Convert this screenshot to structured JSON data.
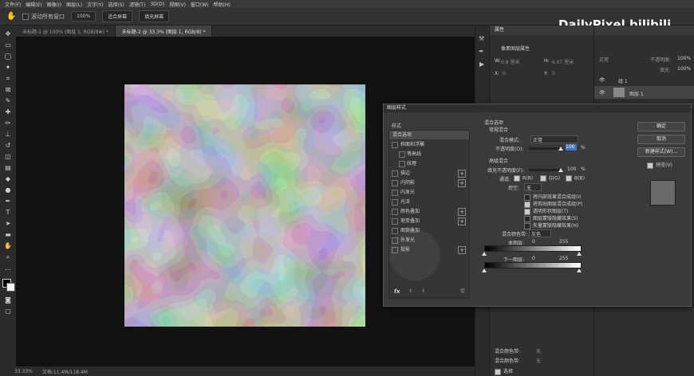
{
  "menubar": {
    "items": [
      "文件(F)",
      "编辑(E)",
      "图像(I)",
      "图层(L)",
      "文字(Y)",
      "选择(S)",
      "滤镜(T)",
      "3D(D)",
      "视图(V)",
      "窗口(W)",
      "帮助(H)"
    ]
  },
  "options": {
    "scroll_all_label": "滚动所有窗口",
    "zoom_value": "100%",
    "fit_screen_label": "适合屏幕",
    "fill_screen_label": "填充屏幕"
  },
  "tabs": [
    {
      "label": "未标题-1 @ 100% (图层 1, RGB/8#) *"
    },
    {
      "label": "未标题-2 @ 33.3% (图层 1, RGB/8) *"
    }
  ],
  "status": {
    "zoom": "33.33%",
    "doc": "文档:11.4M/118.4M"
  },
  "watermark": {
    "text": "DailyPixel bilibili"
  },
  "properties": {
    "title": "属性",
    "subtitle": "像素图层属性",
    "w_label": "W:",
    "w_value": "6.8 厘米",
    "h_label": "H:",
    "h_value": "6.67 厘米",
    "x_label": "X:",
    "x_value": "0",
    "y_label": "Y:",
    "y_value": "0"
  },
  "layers": {
    "blend_mode": "正常",
    "opacity_label": "不透明度:",
    "opacity": "100%",
    "fill_label": "填充:",
    "fill": "100%",
    "group_name": "组 1",
    "layer_name": "图层 1"
  },
  "dialog": {
    "title": "图层样式",
    "styles_header": "样式",
    "style_items": [
      {
        "label": "混合选项",
        "checkbox": false,
        "plus": false,
        "sel": true
      },
      {
        "label": "斜面和浮雕",
        "checkbox": true,
        "plus": false
      },
      {
        "label": "等高线",
        "checkbox": true,
        "plus": false
      },
      {
        "label": "纹理",
        "checkbox": true,
        "plus": false
      },
      {
        "label": "描边",
        "checkbox": true,
        "plus": true
      },
      {
        "label": "内阴影",
        "checkbox": true,
        "plus": true
      },
      {
        "label": "内发光",
        "checkbox": true,
        "plus": false
      },
      {
        "label": "光泽",
        "checkbox": true,
        "plus": false
      },
      {
        "label": "颜色叠加",
        "checkbox": true,
        "plus": true
      },
      {
        "label": "渐变叠加",
        "checkbox": true,
        "plus": true
      },
      {
        "label": "图案叠加",
        "checkbox": true,
        "plus": false
      },
      {
        "label": "外发光",
        "checkbox": true,
        "plus": false
      },
      {
        "label": "投影",
        "checkbox": true,
        "plus": true
      }
    ],
    "blend_options": {
      "section": "混合选项",
      "general": "常规混合",
      "mode_label": "混合模式:",
      "mode_value": "正常",
      "opacity_label": "不透明度(O):",
      "opacity_value": "100",
      "opacity_unit": "%",
      "advanced": "高级混合",
      "fill_label": "填充不透明度(F):",
      "fill_value": "100",
      "fill_unit": "%",
      "channel_label": "通道:",
      "channel_r": "R(R)",
      "channel_g": "G(G)",
      "channel_b": "B(B)",
      "knockout_label": "挖空:",
      "knockout_value": "无",
      "cb1": "将内部效果混合成组(I)",
      "cb2": "将剪贴图层混合成组(P)",
      "cb3": "透明形状图层(T)",
      "cb4": "图层蒙版隐藏效果(S)",
      "cb5": "矢量蒙版隐藏效果(H)",
      "blendif_label": "混合颜色带:",
      "blendif_value": "灰色",
      "this_layer": "本图层:",
      "under_layer": "下一图层:",
      "range_min": "0",
      "range_max": "255"
    },
    "buttons": {
      "ok": "确定",
      "cancel": "取消",
      "new_style": "新建样式(W)...",
      "preview": "预览(V)"
    },
    "fx": "fx"
  },
  "lower_props": {
    "r1": "混合颜色带:",
    "r1v": "无",
    "r2": "混合颜色带:",
    "r2v": "无",
    "chk": "选择"
  },
  "colors": {
    "accent": "#3a75c4"
  }
}
